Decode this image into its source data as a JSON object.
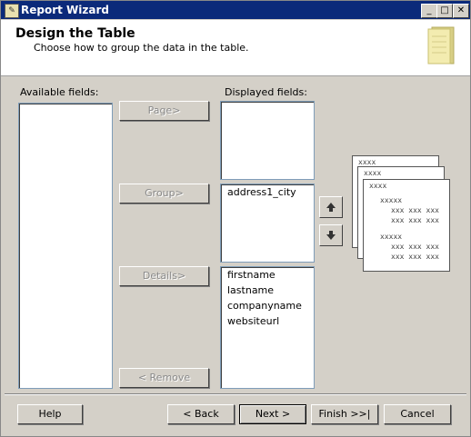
{
  "window": {
    "title": "Report Wizard",
    "min_glyph": "_",
    "max_glyph": "□",
    "close_glyph": "✕"
  },
  "header": {
    "title": "Design the Table",
    "subtitle": "Choose how to group the data in the table."
  },
  "available": {
    "label": "Available fields:",
    "items": []
  },
  "displayed": {
    "label": "Displayed fields:",
    "page_items": [],
    "group_items": [
      "address1_city"
    ],
    "detail_items": [
      "firstname",
      "lastname",
      "companyname",
      "websiteurl"
    ]
  },
  "buttons": {
    "page": "Page>",
    "group": "Group>",
    "details": "Details>",
    "remove": "< Remove",
    "help": "Help",
    "back": "< Back",
    "next": "Next >",
    "finish": "Finish >>|",
    "cancel": "Cancel"
  },
  "preview": {
    "card1_header": "xxxx",
    "card2_header": "xxxx",
    "card3_header": "xxxx",
    "group_label": "xxxxx",
    "row1": "xxx xxx xxx",
    "row2": "xxx xxx xxx"
  }
}
